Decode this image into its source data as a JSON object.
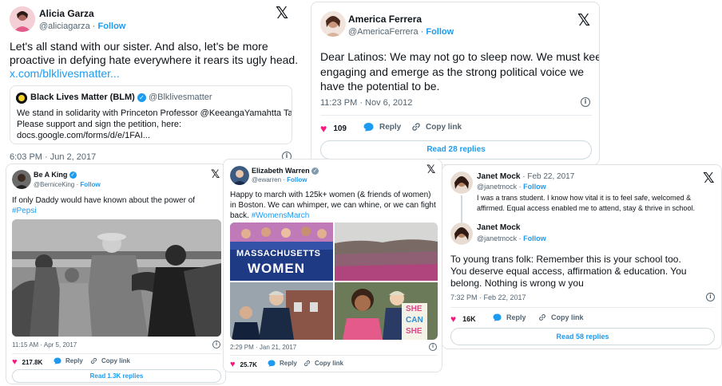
{
  "tweet1": {
    "name": "Alicia Garza",
    "handle": "@aliciagarza",
    "follow": "Follow",
    "text1": "Let's all stand with our sister. And also, let's be more",
    "text2": "proactive in defying hate everywhere it rears its ugly head.",
    "link": "x.com/blklivesmatter...",
    "quote": {
      "name": "Black Lives Matter (BLM)",
      "handle": "@Blklivesmatter",
      "line1": "We stand in solidarity with Princeton Professor @KeeangaYamahtta Taylor.",
      "line2": "Please support and sign the petition, here:",
      "line3": "docs.google.com/forms/d/e/1FAI..."
    },
    "time": "6:03 PM · Jun 2, 2017"
  },
  "tweet2": {
    "name": "America Ferrera",
    "handle": "@AmericaFerrera",
    "follow": "Follow",
    "text1": "Dear Latinos: We may not go to sleep now. We must keep",
    "text2": "engaging and emerge as the strong political voice we",
    "text3": "have the potential to be.",
    "time": "11:23 PM · Nov 6, 2012",
    "likes": "109",
    "reply": "Reply",
    "copy": "Copy link",
    "read_replies": "Read 28 replies"
  },
  "tweet3": {
    "name": "Be A King",
    "handle": "@BerniceKing",
    "follow": "Follow",
    "text1": "If only Daddy would have known about the power of",
    "hashtag": "#Pepsi",
    "time": "11:15 AM · Apr 5, 2017",
    "likes": "217.8K",
    "reply": "Reply",
    "copy": "Copy link",
    "read_replies": "Read 1.3K replies"
  },
  "tweet4": {
    "name": "Elizabeth Warren",
    "handle": "@ewarren",
    "follow": "Follow",
    "text1": "Happy to march with 125k+ women (& friends of women)",
    "text2": "in Boston. We can whimper, we can whine, or we can fight",
    "text3": "back.",
    "hashtag": "#WomensMarch",
    "sign1": "MASSACHUSETTS",
    "sign2": "WOMEN",
    "sign3a": "SHE",
    "sign3b": "CAN",
    "sign3c": "SHE",
    "time": "2:29 PM · Jan 21, 2017",
    "likes": "25.7K",
    "reply": "Reply",
    "copy": "Copy link"
  },
  "tweet5": {
    "name": "Janet Mock",
    "date": "· Feb 22, 2017",
    "handle": "@janetmock",
    "follow": "Follow",
    "parent1": "I was a trans student. I know how vital it is to feel safe, welcomed &",
    "parent2": "affirmed. Equal access enabled me to attend, stay & thrive in school.",
    "name2": "Janet Mock",
    "handle2": "@janetmock",
    "follow2": "Follow",
    "text1": "To young trans folk: Remember this is your school too.",
    "text2": "You deserve equal access, affirmation & education. You",
    "text3": "belong. Nothing is wrong w you",
    "time": "7:32 PM · Feb 22, 2017",
    "likes": "16K",
    "reply": "Reply",
    "copy": "Copy link",
    "read_replies": "Read 58 replies"
  },
  "icons": {
    "x_logo": "𝕏",
    "info": "i",
    "heart": "♥",
    "reply": "speech-bubble",
    "link": "🔗",
    "verified": "✓"
  },
  "colors": {
    "accent": "#1d9bf0",
    "like": "#f91880",
    "text": "#0f1419",
    "muted": "#536471"
  }
}
